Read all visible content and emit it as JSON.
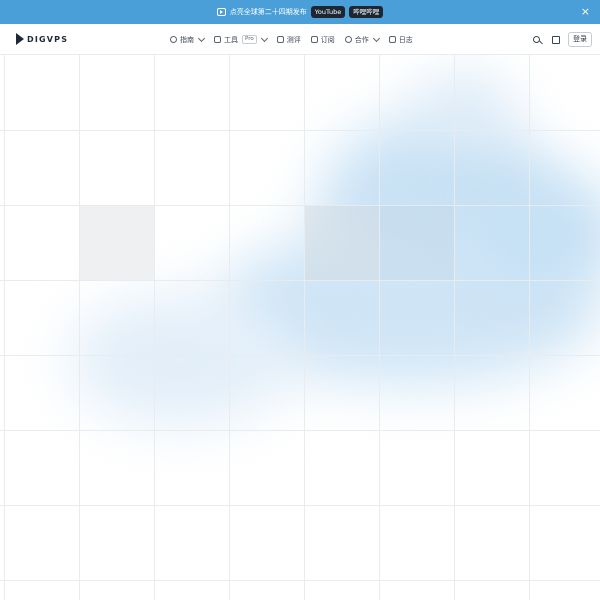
{
  "announcement": {
    "text": "点亮全球第二十四期发布",
    "youtube_label": "YouTube",
    "bilibili_label": "哔哩哔哩",
    "close_label": "×"
  },
  "header": {
    "logo_text": "DIGVPS",
    "nav": [
      {
        "label": "指南",
        "icon": "compass-icon",
        "has_dropdown": true
      },
      {
        "label": "工具",
        "icon": "cube-icon",
        "badge": "Pro",
        "has_dropdown": true
      },
      {
        "label": "测评",
        "icon": "document-icon",
        "has_dropdown": false
      },
      {
        "label": "订阅",
        "icon": "rss-icon",
        "has_dropdown": false
      },
      {
        "label": "合作",
        "icon": "handshake-icon",
        "has_dropdown": true
      },
      {
        "label": "日志",
        "icon": "calendar-icon",
        "has_dropdown": false
      }
    ],
    "search_icon": "search-icon",
    "language_icon": "translate-icon",
    "login_label": "登录"
  },
  "colors": {
    "announcement_bg": "#4a9fd8",
    "accent_blob": "#bcdcf3",
    "text_dark": "#1e2a38"
  }
}
